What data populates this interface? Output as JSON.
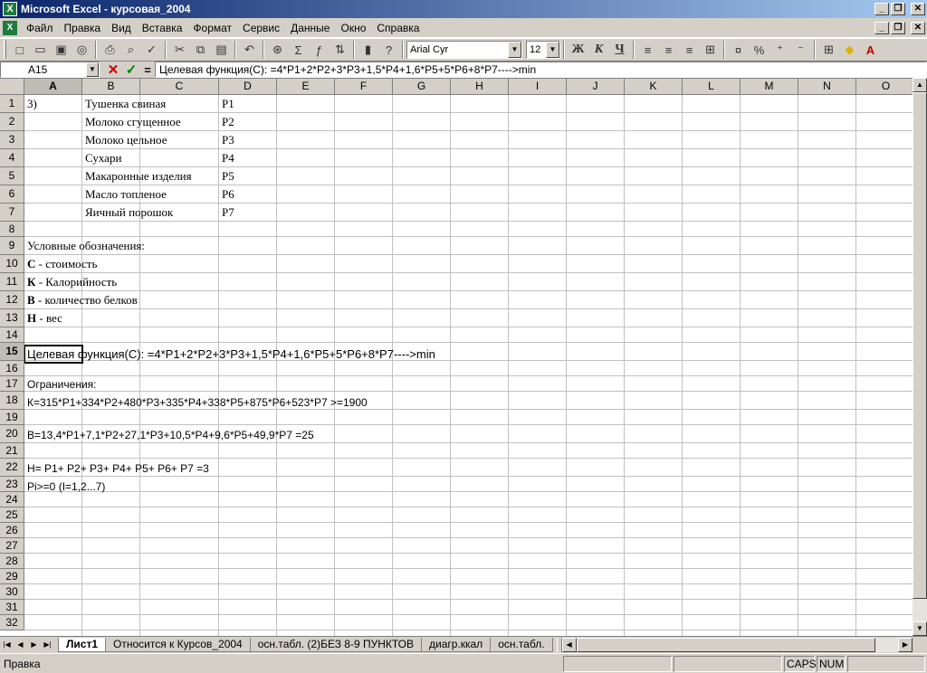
{
  "window": {
    "title": "Microsoft Excel - курсовая_2004",
    "app_icon": "excel-icon"
  },
  "menu": {
    "items": [
      "Файл",
      "Правка",
      "Вид",
      "Вставка",
      "Формат",
      "Сервис",
      "Данные",
      "Окно",
      "Справка"
    ]
  },
  "toolbar": {
    "font_name": "Arial Cyr",
    "font_size": "12",
    "bold_label": "Ж",
    "italic_label": "К",
    "underline_label": "Ч"
  },
  "formula_bar": {
    "name_box": "A15",
    "equals": "=",
    "content": "Целевая функция(C): =4*P1+2*P2+3*P3+1,5*P4+1,6*P5+5*P6+8*P7---->min"
  },
  "grid": {
    "columns": [
      "A",
      "B",
      "C",
      "D",
      "E",
      "F",
      "G",
      "H",
      "I",
      "J",
      "K",
      "L",
      "M",
      "N",
      "O"
    ],
    "rows": [
      "1",
      "2",
      "3",
      "4",
      "5",
      "6",
      "7",
      "8",
      "9",
      "10",
      "11",
      "12",
      "13",
      "14",
      "15",
      "16",
      "17",
      "18",
      "19",
      "20",
      "21",
      "22",
      "23",
      "24",
      "25",
      "26",
      "27",
      "28",
      "29",
      "30",
      "31",
      "32"
    ],
    "active_column": "A",
    "active_row": "15",
    "cells": {
      "a1": "3)",
      "b1": "Тушенка свиная",
      "d1": "P1",
      "b2": "Молоко сгущенное",
      "d2": "P2",
      "b3": "Молоко цельное",
      "d3": "P3",
      "b4": "Сухари",
      "d4": "P4",
      "b5": "Макаронные изделия",
      "d5": "P5",
      "b6": "Масло топленое",
      "d6": "P6",
      "b7": "Яичный порошок",
      "d7": "P7",
      "a9": "Условные обозначения:",
      "a10_bold": "С",
      "a10_rest": " - стоимость",
      "a11_bold": "К",
      "a11_rest": " - Калорийность",
      "a12_bold": "В",
      "a12_rest": " - количество белков",
      "a13_bold": "Н",
      "a13_rest": " - вес",
      "a15": "Целевая функция(C): =4*P1+2*P2+3*P3+1,5*P4+1,6*P5+5*P6+8*P7---->min",
      "a17": "Ограничения:",
      "a18": "К=315*P1+334*P2+480*P3+335*P4+338*P5+875*P6+523*P7 >=1900",
      "a20": "В=13,4*P1+7,1*P2+27,1*P3+10,5*P4+9,6*P5+49,9*P7 =25",
      "a22": "Н= P1+ P2+ P3+ P4+ P5+ P6+ P7 =3",
      "a23": "Pi>=0    (I=1,2...7)"
    }
  },
  "sheet_tabs": [
    "Лист1",
    "Относится к Курсов_2004",
    "осн.табл. (2)БЕЗ 8-9 ПУНКТОВ",
    "диагр.ккал",
    "осн.табл."
  ],
  "active_sheet": "Лист1",
  "status": {
    "text": "Правка",
    "caps": "CAPS",
    "num": "NUM"
  }
}
